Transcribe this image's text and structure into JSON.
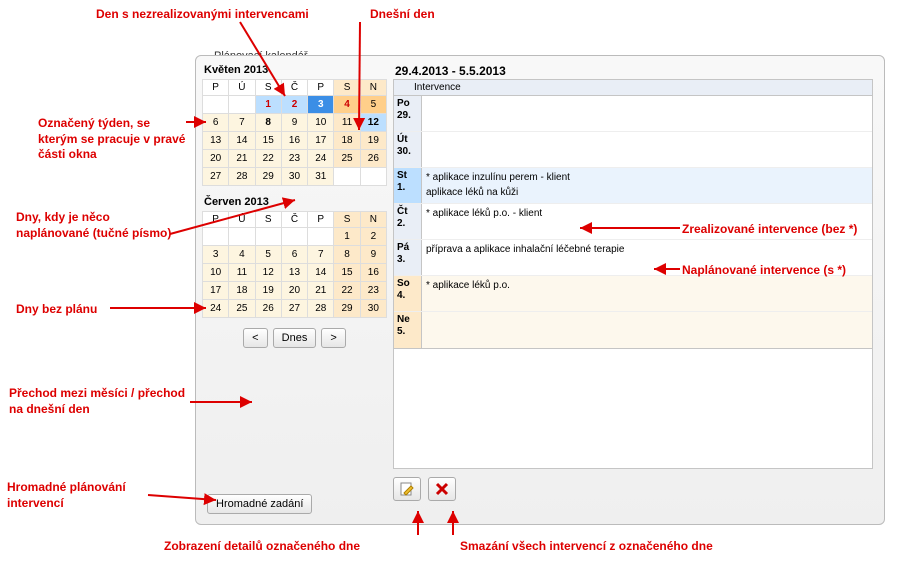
{
  "panel_title": "Plánovací kalendář",
  "month1": {
    "title": "Květen 2013",
    "dow": [
      "P",
      "Ú",
      "S",
      "Č",
      "P",
      "S",
      "N"
    ],
    "rows": [
      [
        {
          "v": "",
          "c": "empty"
        },
        {
          "v": "",
          "c": "empty"
        },
        {
          "v": "1",
          "c": "red"
        },
        {
          "v": "2",
          "c": "red"
        },
        {
          "v": "3",
          "c": "sel bold"
        },
        {
          "v": "4",
          "c": "red-wknd"
        },
        {
          "v": "5",
          "c": "wknd-sel"
        }
      ],
      [
        {
          "v": "6",
          "c": "def"
        },
        {
          "v": "7",
          "c": "def"
        },
        {
          "v": "8",
          "c": "def bold"
        },
        {
          "v": "9",
          "c": "def"
        },
        {
          "v": "10",
          "c": "def"
        },
        {
          "v": "11",
          "c": "wknd"
        },
        {
          "v": "12",
          "c": "today bold"
        }
      ],
      [
        {
          "v": "13",
          "c": "def"
        },
        {
          "v": "14",
          "c": "def"
        },
        {
          "v": "15",
          "c": "def"
        },
        {
          "v": "16",
          "c": "def"
        },
        {
          "v": "17",
          "c": "def"
        },
        {
          "v": "18",
          "c": "wknd"
        },
        {
          "v": "19",
          "c": "wknd"
        }
      ],
      [
        {
          "v": "20",
          "c": "def"
        },
        {
          "v": "21",
          "c": "def"
        },
        {
          "v": "22",
          "c": "def"
        },
        {
          "v": "23",
          "c": "def"
        },
        {
          "v": "24",
          "c": "def"
        },
        {
          "v": "25",
          "c": "wknd"
        },
        {
          "v": "26",
          "c": "wknd"
        }
      ],
      [
        {
          "v": "27",
          "c": "def"
        },
        {
          "v": "28",
          "c": "def"
        },
        {
          "v": "29",
          "c": "def"
        },
        {
          "v": "30",
          "c": "def"
        },
        {
          "v": "31",
          "c": "def"
        },
        {
          "v": "",
          "c": "empty"
        },
        {
          "v": "",
          "c": "empty"
        }
      ]
    ]
  },
  "month2": {
    "title": "Červen 2013",
    "dow": [
      "P",
      "Ú",
      "S",
      "Č",
      "P",
      "S",
      "N"
    ],
    "rows": [
      [
        {
          "v": "",
          "c": "empty"
        },
        {
          "v": "",
          "c": "empty"
        },
        {
          "v": "",
          "c": "empty"
        },
        {
          "v": "",
          "c": "empty"
        },
        {
          "v": "",
          "c": "empty"
        },
        {
          "v": "1",
          "c": "wknd"
        },
        {
          "v": "2",
          "c": "wknd"
        }
      ],
      [
        {
          "v": "3",
          "c": "def"
        },
        {
          "v": "4",
          "c": "def"
        },
        {
          "v": "5",
          "c": "def"
        },
        {
          "v": "6",
          "c": "def"
        },
        {
          "v": "7",
          "c": "def"
        },
        {
          "v": "8",
          "c": "wknd"
        },
        {
          "v": "9",
          "c": "wknd"
        }
      ],
      [
        {
          "v": "10",
          "c": "def"
        },
        {
          "v": "11",
          "c": "def"
        },
        {
          "v": "12",
          "c": "def"
        },
        {
          "v": "13",
          "c": "def"
        },
        {
          "v": "14",
          "c": "def"
        },
        {
          "v": "15",
          "c": "wknd"
        },
        {
          "v": "16",
          "c": "wknd"
        }
      ],
      [
        {
          "v": "17",
          "c": "def"
        },
        {
          "v": "18",
          "c": "def"
        },
        {
          "v": "19",
          "c": "def"
        },
        {
          "v": "20",
          "c": "def"
        },
        {
          "v": "21",
          "c": "def"
        },
        {
          "v": "22",
          "c": "wknd"
        },
        {
          "v": "23",
          "c": "wknd"
        }
      ],
      [
        {
          "v": "24",
          "c": "def"
        },
        {
          "v": "25",
          "c": "def"
        },
        {
          "v": "26",
          "c": "def"
        },
        {
          "v": "27",
          "c": "def"
        },
        {
          "v": "28",
          "c": "def"
        },
        {
          "v": "29",
          "c": "wknd"
        },
        {
          "v": "30",
          "c": "wknd"
        }
      ]
    ]
  },
  "nav": {
    "prev": "<",
    "today": "Dnes",
    "next": ">"
  },
  "bulk": "Hromadné zadání",
  "range": "29.4.2013 - 5.5.2013",
  "intv_header": "Intervence",
  "days": [
    {
      "lbl1": "Po",
      "lbl2": "29.",
      "cls": "",
      "items": []
    },
    {
      "lbl1": "Út",
      "lbl2": "30.",
      "cls": "",
      "items": []
    },
    {
      "lbl1": "St",
      "lbl2": "1.",
      "cls": "sel",
      "items": [
        "* aplikace inzulínu perem - klient",
        "aplikace léků na kůži"
      ]
    },
    {
      "lbl1": "Čt",
      "lbl2": "2.",
      "cls": "",
      "items": [
        "* aplikace léků p.o. - klient"
      ]
    },
    {
      "lbl1": "Pá",
      "lbl2": "3.",
      "cls": "",
      "items": [
        "příprava a aplikace inhalační léčebné terapie"
      ]
    },
    {
      "lbl1": "So",
      "lbl2": "4.",
      "cls": "wknd",
      "items": [
        "* aplikace léků p.o."
      ]
    },
    {
      "lbl1": "Ne",
      "lbl2": "5.",
      "cls": "wknd",
      "items": []
    }
  ],
  "ann": {
    "a1": "Den s nezrealizovanými intervencami",
    "a2": "Dnešní den",
    "a3": "Označený týden, se kterým se pracuje v pravé části okna",
    "a4": "Dny, kdy je něco naplánované (tučné písmo)",
    "a5": "Dny bez plánu",
    "a6": "Přechod mezi měsíci / přechod na dnešní den",
    "a7": "Hromadné plánování intervencí",
    "a8": "Zrealizované intervence (bez *)",
    "a9": "Naplánované intervence (s *)",
    "a10": "Zobrazení detailů označeného dne",
    "a11": "Smazání všech intervencí  z označeného dne"
  }
}
